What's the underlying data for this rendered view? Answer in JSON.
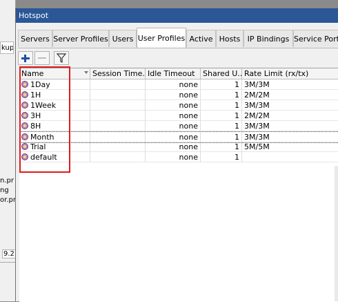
{
  "background": {
    "fragments": [
      "kup",
      "n.pr",
      "ng",
      "or.pr",
      "9.2"
    ]
  },
  "window": {
    "title": "Hotspot"
  },
  "tabs": [
    {
      "label": "Servers",
      "active": false
    },
    {
      "label": "Server Profiles",
      "active": false
    },
    {
      "label": "Users",
      "active": false
    },
    {
      "label": "User Profiles",
      "active": true
    },
    {
      "label": "Active",
      "active": false
    },
    {
      "label": "Hosts",
      "active": false
    },
    {
      "label": "IP Bindings",
      "active": false
    },
    {
      "label": "Service Ports",
      "active": false
    }
  ],
  "toolbar": {
    "add_icon": "plus-icon",
    "remove_icon": "minus-icon",
    "filter_icon": "filter-icon"
  },
  "table": {
    "columns": [
      "Name",
      "Session Time...",
      "Idle Timeout",
      "Shared U...",
      "Rate Limit (rx/tx)"
    ],
    "rows": [
      {
        "name": "1Day",
        "session": "",
        "idle": "none",
        "shared": "1",
        "rate": "3M/3M"
      },
      {
        "name": "1H",
        "session": "",
        "idle": "none",
        "shared": "1",
        "rate": "2M/2M"
      },
      {
        "name": "1Week",
        "session": "",
        "idle": "none",
        "shared": "1",
        "rate": "3M/3M"
      },
      {
        "name": "3H",
        "session": "",
        "idle": "none",
        "shared": "1",
        "rate": "2M/2M"
      },
      {
        "name": "8H",
        "session": "",
        "idle": "none",
        "shared": "1",
        "rate": "3M/3M"
      },
      {
        "name": "Month",
        "session": "",
        "idle": "none",
        "shared": "1",
        "rate": "3M/3M"
      },
      {
        "name": "Trial",
        "session": "",
        "idle": "none",
        "shared": "1",
        "rate": "5M/5M"
      },
      {
        "name": "default",
        "session": "",
        "idle": "none",
        "shared": "1",
        "rate": ""
      }
    ]
  },
  "colors": {
    "titlebar": "#2b5797",
    "highlight": "#e01b1b",
    "profile_icon": "#b88ab8"
  }
}
